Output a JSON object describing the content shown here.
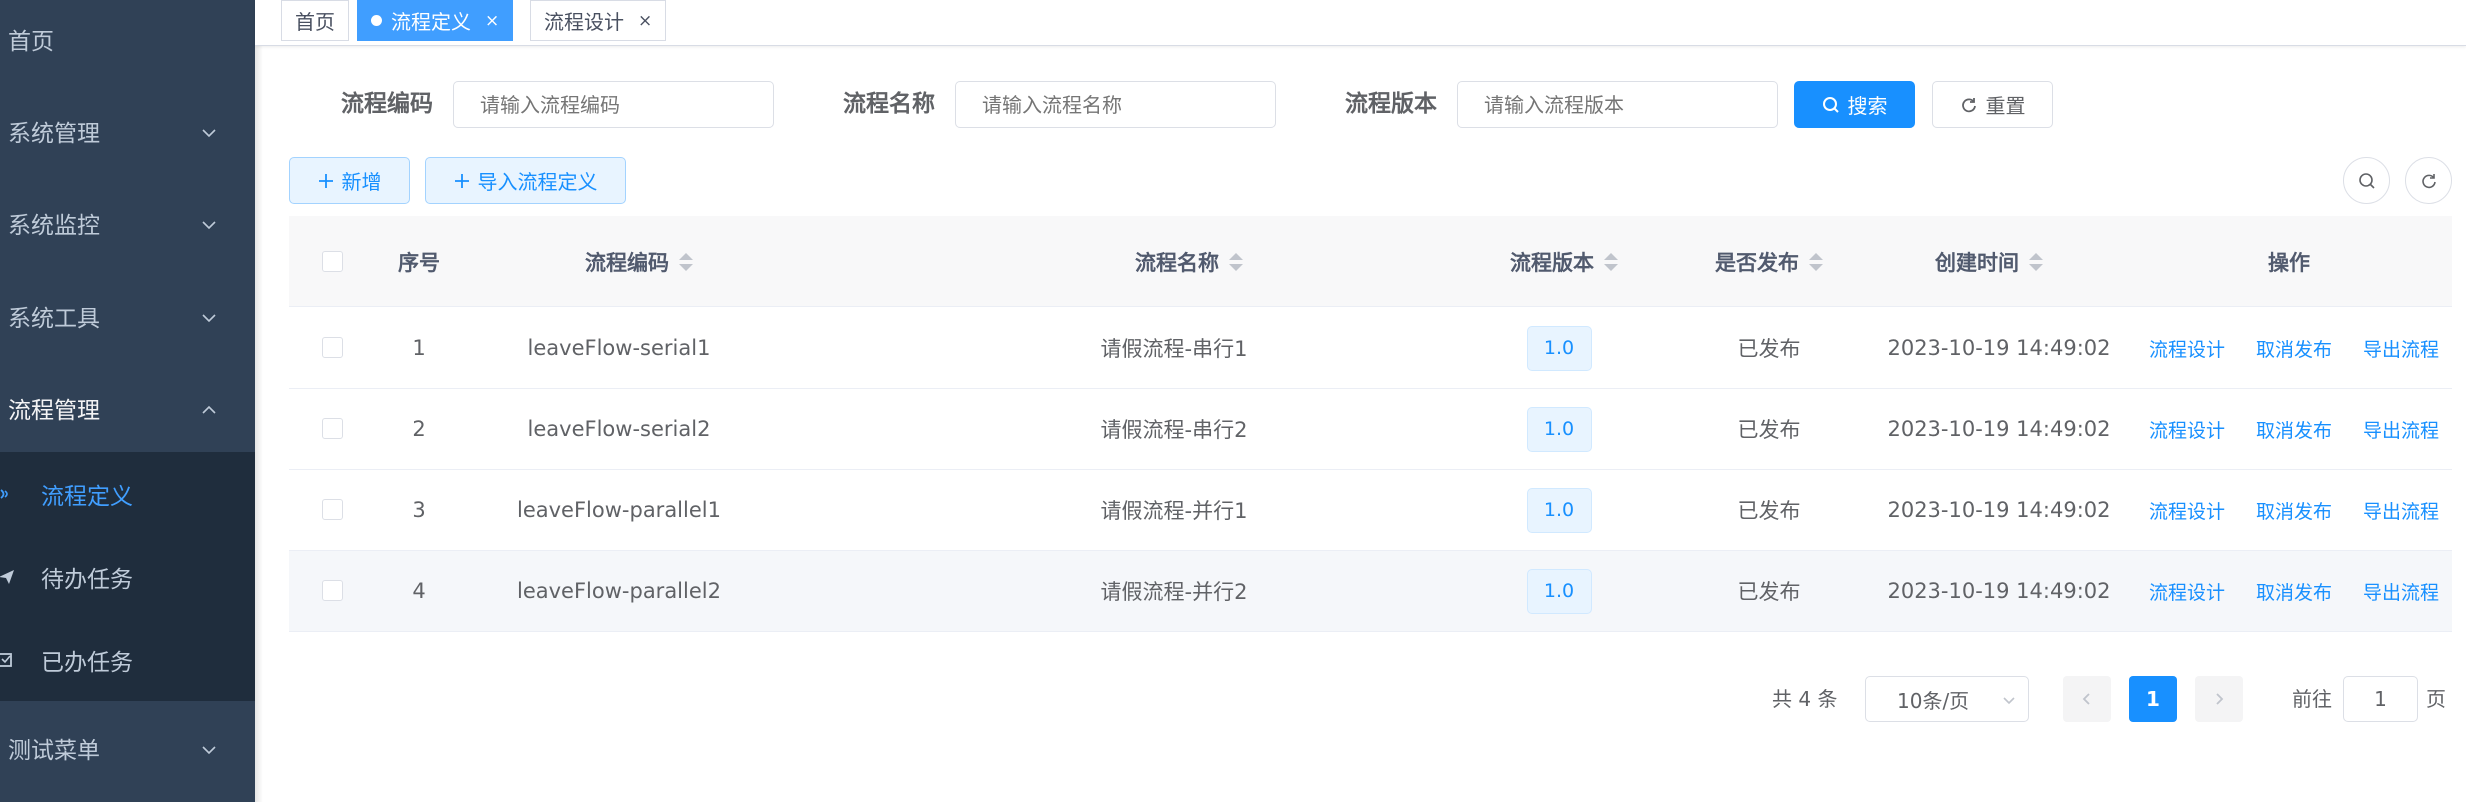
{
  "sidebar": {
    "items": [
      {
        "label": "首页"
      },
      {
        "label": "系统管理"
      },
      {
        "label": "系统监控"
      },
      {
        "label": "系统工具"
      },
      {
        "label": "流程管理"
      },
      {
        "label": "测试菜单"
      }
    ],
    "sub_items": [
      {
        "label": "流程定义",
        "active": true
      },
      {
        "label": "待办任务"
      },
      {
        "label": "已办任务"
      }
    ]
  },
  "tags": [
    {
      "label": "首页"
    },
    {
      "label": "流程定义",
      "close": "×"
    },
    {
      "label": "流程设计",
      "close": "×"
    }
  ],
  "search": {
    "fields": [
      {
        "label": "流程编码",
        "placeholder": "请输入流程编码"
      },
      {
        "label": "流程名称",
        "placeholder": "请输入流程名称"
      },
      {
        "label": "流程版本",
        "placeholder": "请输入流程版本"
      }
    ],
    "search_label": "搜索",
    "reset_label": "重置"
  },
  "toolbar": {
    "add_label": "新增",
    "import_label": "导入流程定义"
  },
  "table": {
    "headers": {
      "index": "序号",
      "code": "流程编码",
      "name": "流程名称",
      "version": "流程版本",
      "published": "是否发布",
      "created": "创建时间",
      "actions": "操作"
    },
    "rows": [
      {
        "index": "1",
        "code": "leaveFlow-serial1",
        "name": "请假流程-串行1",
        "version": "1.0",
        "published": "已发布",
        "created": "2023-10-19 14:49:02"
      },
      {
        "index": "2",
        "code": "leaveFlow-serial2",
        "name": "请假流程-串行2",
        "version": "1.0",
        "published": "已发布",
        "created": "2023-10-19 14:49:02"
      },
      {
        "index": "3",
        "code": "leaveFlow-parallel1",
        "name": "请假流程-并行1",
        "version": "1.0",
        "published": "已发布",
        "created": "2023-10-19 14:49:02"
      },
      {
        "index": "4",
        "code": "leaveFlow-parallel2",
        "name": "请假流程-并行2",
        "version": "1.0",
        "published": "已发布",
        "created": "2023-10-19 14:49:02"
      }
    ],
    "actions": {
      "design": "流程设计",
      "unpublish": "取消发布",
      "export": "导出流程"
    }
  },
  "pagination": {
    "total": "共 4 条",
    "page_size": "10条/页",
    "current_page": "1",
    "goto_label": "前往",
    "goto_value": "1",
    "page_suffix": "页"
  },
  "colors": {
    "sidebar_bg": "#304156",
    "submenu_bg": "#1f2d3d",
    "accent": "#1890ff",
    "active_menu_text": "#409eff"
  }
}
